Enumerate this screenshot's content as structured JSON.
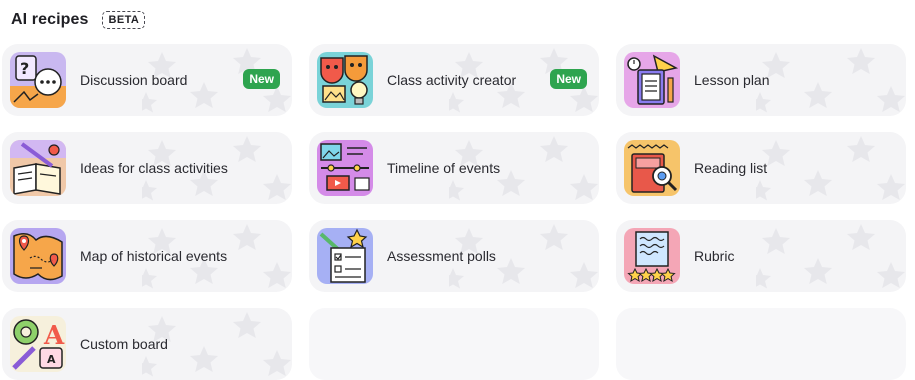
{
  "header": {
    "title": "AI recipes",
    "beta_label": "BETA"
  },
  "recipes": [
    {
      "label": "Discussion board",
      "badge": "New",
      "icon": "discussion-board-icon"
    },
    {
      "label": "Class activity creator",
      "badge": "New",
      "icon": "class-activity-icon"
    },
    {
      "label": "Lesson plan",
      "icon": "lesson-plan-icon"
    },
    {
      "label": "Ideas for class activities",
      "icon": "class-ideas-icon"
    },
    {
      "label": "Timeline of events",
      "icon": "timeline-icon"
    },
    {
      "label": "Reading list",
      "icon": "reading-list-icon"
    },
    {
      "label": "Map of historical events",
      "icon": "map-icon"
    },
    {
      "label": "Assessment polls",
      "icon": "assessment-polls-icon"
    },
    {
      "label": "Rubric",
      "icon": "rubric-icon"
    },
    {
      "label": "Custom board",
      "icon": "custom-board-icon"
    }
  ],
  "colors": {
    "card_bg": "#f4f4f6",
    "badge_green": "#2ea44f"
  }
}
